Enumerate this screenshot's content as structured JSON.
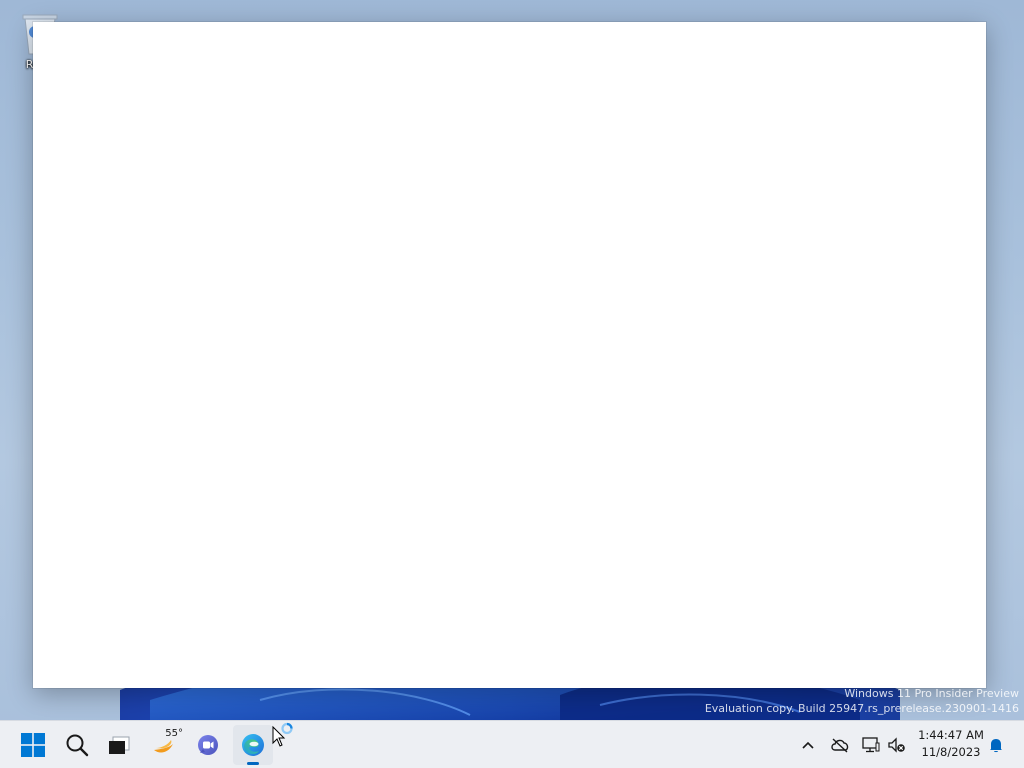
{
  "desktop": {
    "recycle_bin_label": "Recy"
  },
  "watermark": {
    "line1": "Windows 11 Pro Insider Preview",
    "line2": "Evaluation copy. Build 25947.rs_prerelease.230901-1416"
  },
  "taskbar": {
    "items": [
      {
        "name": "start",
        "icon": "windows-logo-icon"
      },
      {
        "name": "search",
        "icon": "search-icon"
      },
      {
        "name": "task-view",
        "icon": "task-view-icon"
      },
      {
        "name": "widgets",
        "icon": "weather-icon"
      },
      {
        "name": "teams-chat",
        "icon": "chat-icon"
      },
      {
        "name": "edge",
        "icon": "edge-icon",
        "active": true
      }
    ],
    "weather_temp": "55°",
    "tray": {
      "icons": [
        "chevron-up-icon",
        "onedrive-offline-icon",
        "network-icon",
        "volume-muted-icon",
        "notification-bell-icon"
      ]
    },
    "clock": {
      "time": "1:44:47 AM",
      "date": "11/8/2023"
    }
  },
  "colors": {
    "accent": "#0067c0",
    "taskbar_bg": "#edeff3",
    "wallpaper_blue": "#1a4fd6"
  }
}
